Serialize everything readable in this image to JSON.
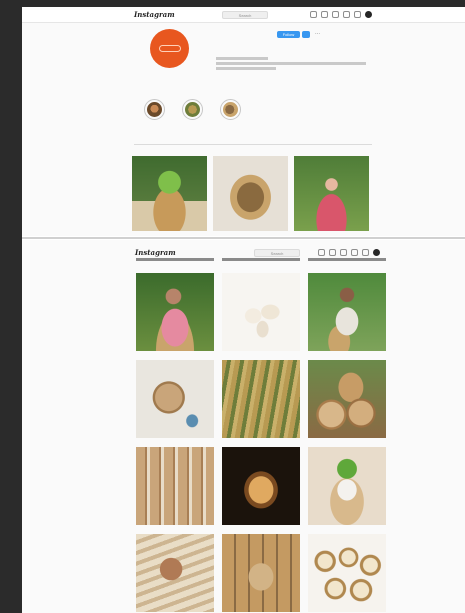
{
  "top_panel": {
    "nav": {
      "logo": "Instagram",
      "search_placeholder": "Search"
    },
    "profile": {
      "username": "",
      "follow_label": "Follow",
      "more_label": "···",
      "stats": [
        "",
        "",
        ""
      ],
      "bio_name": "",
      "bio_text": ""
    },
    "highlights": [
      {
        "label": "",
        "icon": "highlight-basket"
      },
      {
        "label": "",
        "icon": "highlight-reeds"
      },
      {
        "label": "",
        "icon": "highlight-wood"
      }
    ],
    "tabs": [
      {
        "label": "",
        "active": true
      },
      {
        "label": "",
        "active": false
      },
      {
        "label": "",
        "active": false
      }
    ],
    "posts": [
      {
        "subject": "plant-in-basket"
      },
      {
        "subject": "woven-basket"
      },
      {
        "subject": "woman-in-garden"
      }
    ]
  },
  "bottom_panel": {
    "nav": {
      "logo": "Instagram",
      "search_placeholder": "Search"
    },
    "posts": [
      {
        "subject": "woman-with-basket"
      },
      {
        "subject": "white-cups"
      },
      {
        "subject": "woman-with-bowl"
      },
      {
        "subject": "discs-and-bowl"
      },
      {
        "subject": "bamboo-reeds"
      },
      {
        "subject": "wooden-baskets"
      },
      {
        "subject": "wooden-stools"
      },
      {
        "subject": "lit-bowl"
      },
      {
        "subject": "potted-plant"
      },
      {
        "subject": "hands-weaving"
      },
      {
        "subject": "wooden-rings"
      },
      {
        "subject": "circular-trays"
      }
    ]
  },
  "colors": {
    "page_bg": "#2b2b2b",
    "profile_avatar": "#e8571f",
    "follow_button": "#3897f0"
  }
}
